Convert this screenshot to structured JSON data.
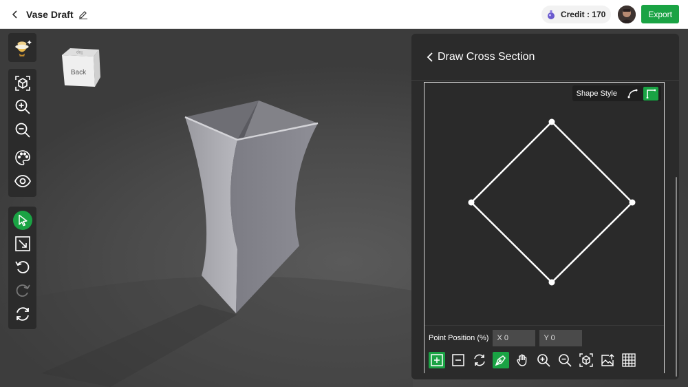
{
  "header": {
    "title": "Vase Draft",
    "credit_label": "Credit : 170",
    "export_label": "Export"
  },
  "view_cube": {
    "face_label": "Back",
    "top_label": "Top"
  },
  "toolbar": {
    "group1": [
      "asset-library"
    ],
    "group2": [
      "fit-view",
      "zoom-in",
      "zoom-out",
      "material",
      "visibility"
    ],
    "group3": [
      "select",
      "scale",
      "undo",
      "redo",
      "reset"
    ]
  },
  "panel": {
    "title": "Draw Cross Section",
    "shape_style_label": "Shape Style",
    "point_position_label": "Point Position (%)",
    "x_value": "X 0",
    "y_value": "Y 0"
  },
  "colors": {
    "accent": "#1aa344",
    "panel": "#2b2b2b"
  }
}
